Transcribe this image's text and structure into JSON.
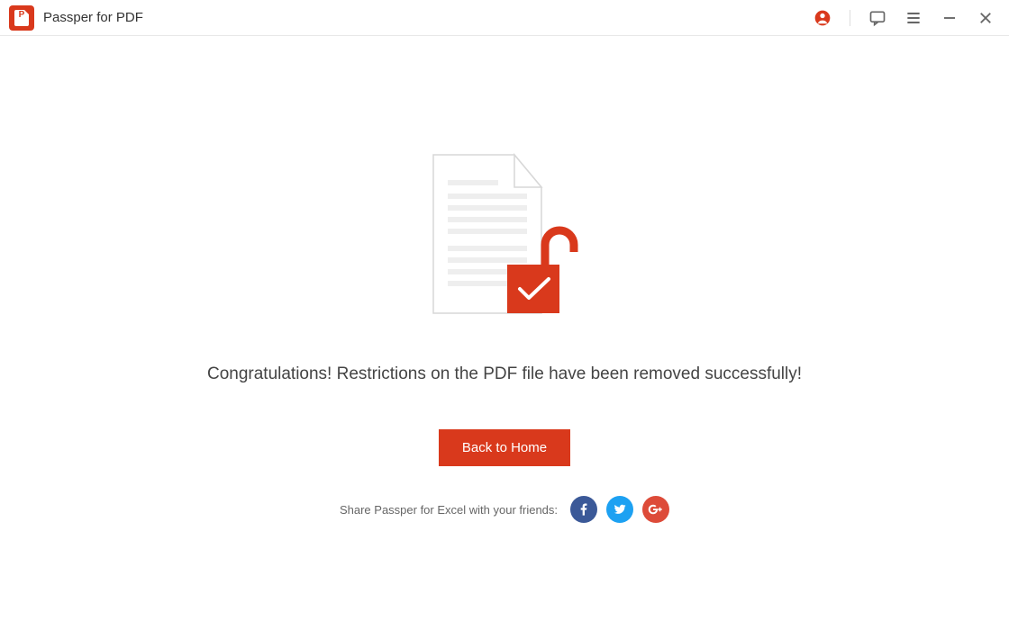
{
  "titlebar": {
    "app_title": "Passper for PDF"
  },
  "main": {
    "message": "Congratulations! Restrictions on the PDF file have been removed successfully!",
    "home_button": "Back to Home",
    "share_text": "Share Passper for Excel with your friends:"
  },
  "colors": {
    "brand": "#d9391c",
    "facebook": "#3b5998",
    "twitter": "#1da1f2",
    "googleplus": "#dd4b39"
  }
}
